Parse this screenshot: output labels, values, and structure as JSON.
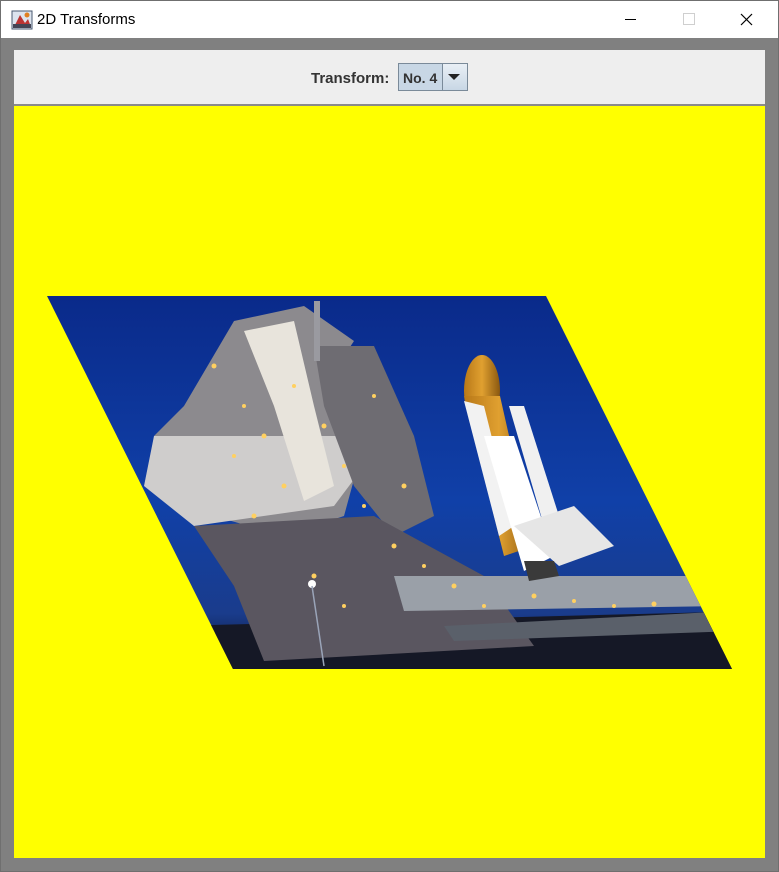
{
  "window": {
    "title": "2D Transforms"
  },
  "toolbar": {
    "transform_label": "Transform:",
    "transform_value": "No. 4"
  },
  "image": {
    "subject": "space shuttle on launch pad at night",
    "transform": "shear"
  },
  "colors": {
    "canvas": "#ffff00",
    "toolbar": "#eeeeee",
    "frame": "#808080"
  }
}
